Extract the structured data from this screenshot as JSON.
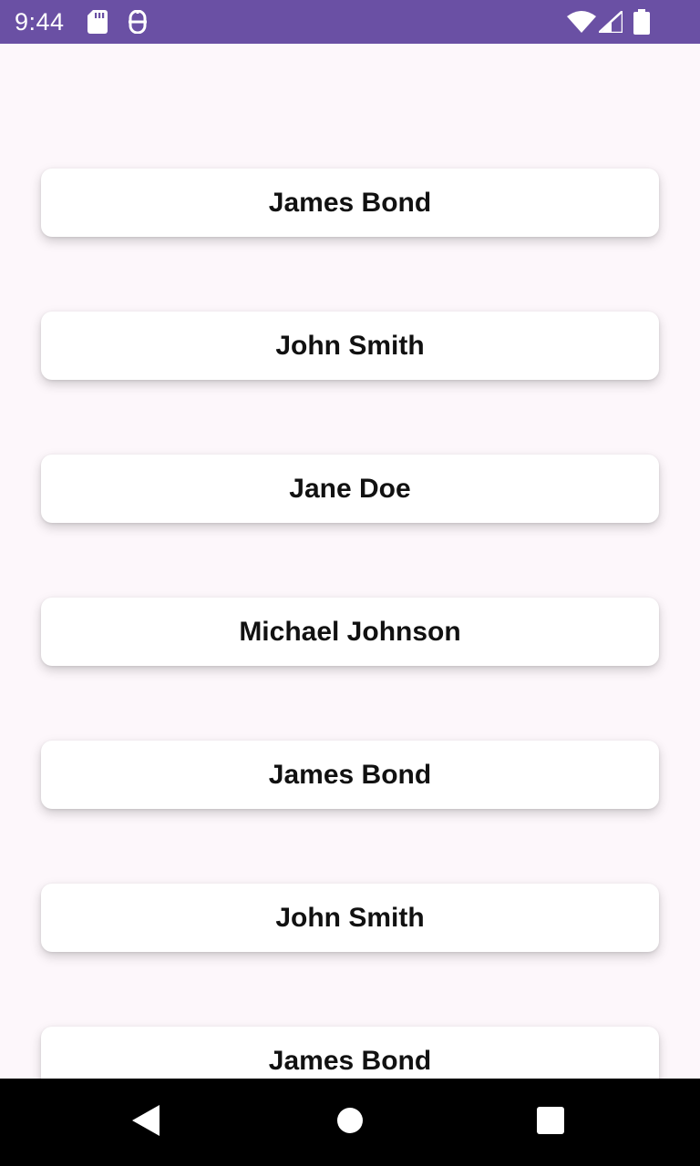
{
  "status_bar": {
    "time": "9:44",
    "background": "#6a50a4",
    "left_icons": [
      "sd-card-icon",
      "notification-icon"
    ],
    "right_icons": [
      "wifi-icon",
      "cell-signal-icon",
      "battery-icon"
    ]
  },
  "list": {
    "items": [
      {
        "label": "James Bond"
      },
      {
        "label": "John Smith"
      },
      {
        "label": "Jane Doe"
      },
      {
        "label": "Michael Johnson"
      },
      {
        "label": "James Bond"
      },
      {
        "label": "John Smith"
      },
      {
        "label": "James Bond"
      }
    ]
  },
  "nav_bar": {
    "buttons": [
      "back-icon",
      "home-icon",
      "recents-icon"
    ]
  }
}
